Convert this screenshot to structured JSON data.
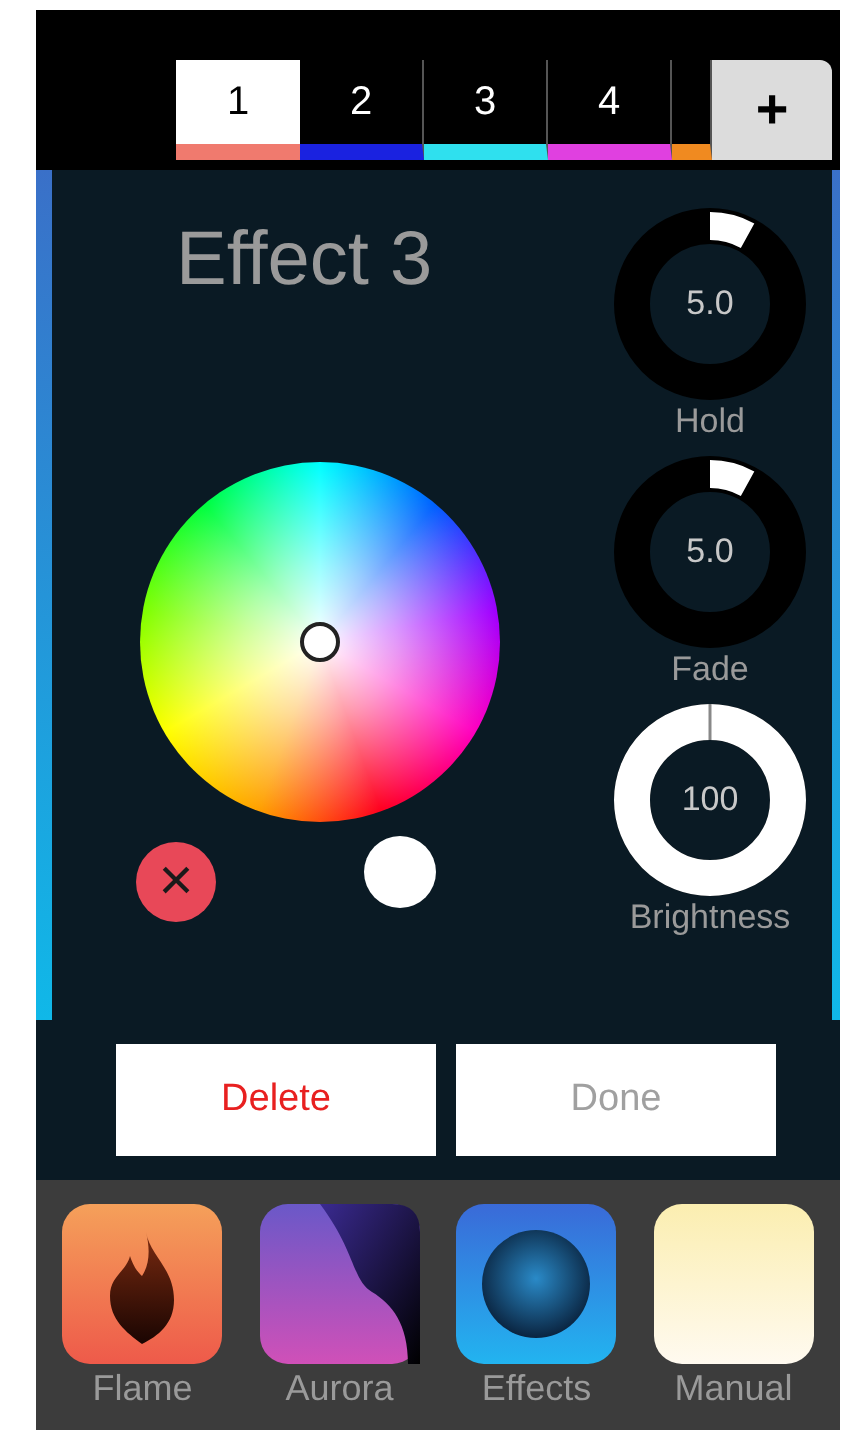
{
  "tabs": [
    {
      "label": "1",
      "color": "#f07a6e",
      "selected": true
    },
    {
      "label": "2",
      "color": "#1a22e0",
      "selected": false
    },
    {
      "label": "3",
      "color": "#2fe0ee",
      "selected": false
    },
    {
      "label": "4",
      "color": "#e040e0",
      "selected": false
    },
    {
      "color": "#f08a20",
      "selected": false
    }
  ],
  "add_button": "+",
  "effect_title": "Effect 3",
  "dials": [
    {
      "kind": "marker",
      "value": "5.0",
      "label": "Hold",
      "level": 0.08
    },
    {
      "kind": "marker",
      "value": "5.0",
      "label": "Fade",
      "level": 0.08
    },
    {
      "kind": "fill",
      "value": "100",
      "label": "Brightness",
      "level": 1
    }
  ],
  "clear_button": "×",
  "actions": [
    {
      "label": "Delete",
      "kind": "destructive"
    },
    {
      "label": "Done",
      "kind": "plain"
    }
  ],
  "dock": [
    {
      "label": "Flame",
      "kind": "flame"
    },
    {
      "label": "Aurora",
      "kind": "aurora"
    },
    {
      "label": "Effects",
      "kind": "effects"
    },
    {
      "label": "Manual",
      "kind": "manual"
    }
  ]
}
